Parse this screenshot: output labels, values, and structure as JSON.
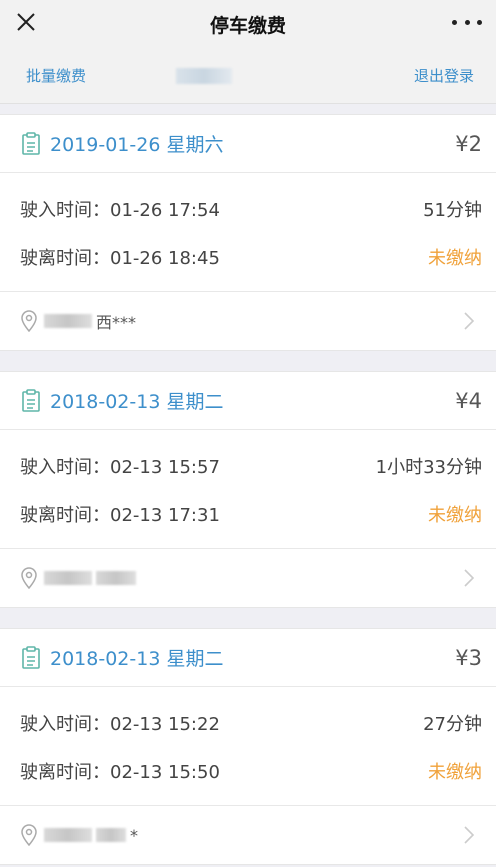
{
  "header": {
    "title": "停车缴费"
  },
  "subbar": {
    "batch_label": "批量缴费",
    "logout_label": "退出登录"
  },
  "records": [
    {
      "date": "2019-01-26 星期六",
      "price": "¥2",
      "in_label": "驶入时间：",
      "in_time": "01-26 17:54",
      "duration": "51分钟",
      "out_label": "驶离时间：",
      "out_time": "01-26 18:45",
      "status": "未缴纳",
      "address": "西***"
    },
    {
      "date": "2018-02-13 星期二",
      "price": "¥4",
      "in_label": "驶入时间：",
      "in_time": "02-13 15:57",
      "duration": "1小时33分钟",
      "out_label": "驶离时间：",
      "out_time": "02-13 17:31",
      "status": "未缴纳",
      "address": ""
    },
    {
      "date": "2018-02-13 星期二",
      "price": "¥3",
      "in_label": "驶入时间：",
      "in_time": "02-13 15:22",
      "duration": "27分钟",
      "out_label": "驶离时间：",
      "out_time": "02-13 15:50",
      "status": "未缴纳",
      "address": "*"
    }
  ],
  "colors": {
    "accent": "#3d8fcb",
    "unpaid": "#f0a23b"
  },
  "icons": {
    "close": "close-icon",
    "more": "more-icon",
    "date": "clipboard-icon",
    "location": "location-pin-icon",
    "chevron": "chevron-right-icon"
  }
}
